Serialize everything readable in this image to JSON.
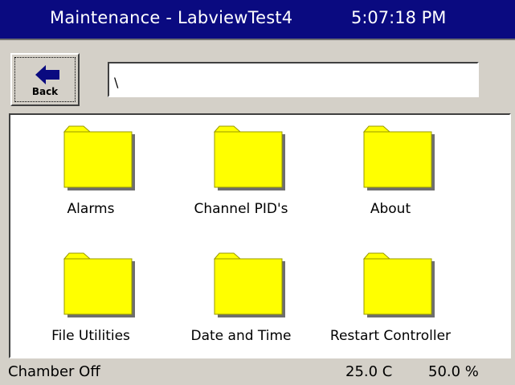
{
  "window": {
    "title": "Maintenance - LabviewTest4",
    "clock": "5:07:18 PM"
  },
  "toolbar": {
    "back_label": "Back",
    "back_icon": "left-arrow-icon",
    "path_value": "\\"
  },
  "folders": [
    {
      "label": "Alarms",
      "icon": "folder-icon"
    },
    {
      "label": "Channel PID's",
      "icon": "folder-icon"
    },
    {
      "label": "About",
      "icon": "folder-icon"
    },
    {
      "label": "File Utilities",
      "icon": "folder-icon"
    },
    {
      "label": "Date and Time",
      "icon": "folder-icon"
    },
    {
      "label": "Restart Controller",
      "icon": "folder-icon"
    }
  ],
  "status": {
    "chamber": "Chamber Off",
    "temperature": "25.0 C",
    "humidity": "50.0 %"
  },
  "colors": {
    "titlebar": "#0a0a80",
    "folder_fill": "#ffff00",
    "panel": "#d4d0c8"
  }
}
